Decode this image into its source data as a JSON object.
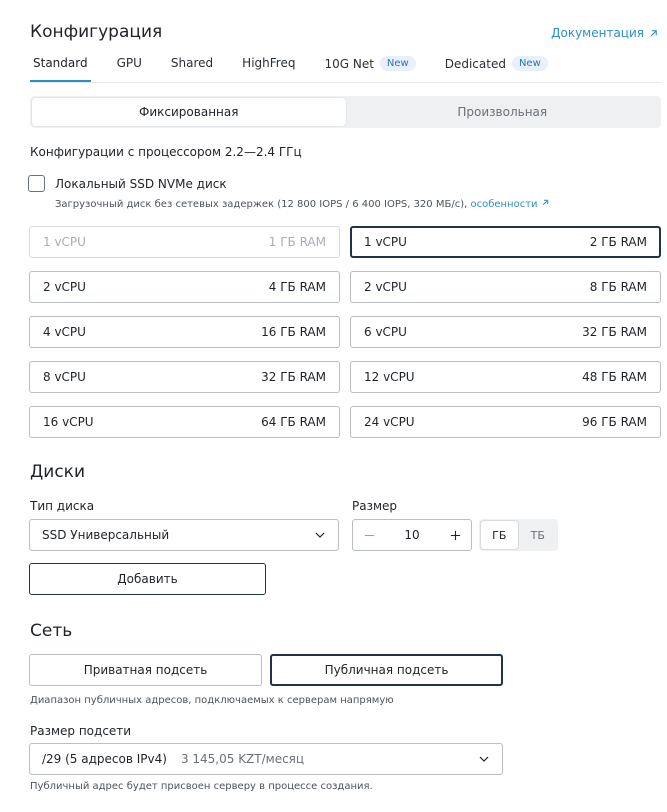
{
  "header": {
    "title": "Конфигурация",
    "docs_link": "Документация"
  },
  "tabs": [
    {
      "label": "Standard",
      "active": true,
      "badge": ""
    },
    {
      "label": "GPU",
      "active": false,
      "badge": ""
    },
    {
      "label": "Shared",
      "active": false,
      "badge": ""
    },
    {
      "label": "HighFreq",
      "active": false,
      "badge": ""
    },
    {
      "label": "10G Net",
      "active": false,
      "badge": "New"
    },
    {
      "label": "Dedicated",
      "active": false,
      "badge": "New"
    }
  ],
  "mode": {
    "fixed": "Фиксированная",
    "custom": "Произвольная",
    "selected": "fixed"
  },
  "cpu_note": "Конфигурации с процессором 2.2—2.4 ГГц",
  "local_ssd": {
    "label": "Локальный SSD NVMe диск",
    "checked": false,
    "hint": "Загрузочный диск без сетевых задержек (12 800 IOPS / 6 400 IOPS, 320 МБ/с),",
    "hint_link": "особенности"
  },
  "configs": [
    {
      "cpu": "1 vCPU",
      "ram": "1 ГБ RAM",
      "state": "disabled"
    },
    {
      "cpu": "1 vCPU",
      "ram": "2 ГБ RAM",
      "state": "selected"
    },
    {
      "cpu": "2 vCPU",
      "ram": "4 ГБ RAM",
      "state": "normal"
    },
    {
      "cpu": "2 vCPU",
      "ram": "8 ГБ RAM",
      "state": "normal"
    },
    {
      "cpu": "4 vCPU",
      "ram": "16 ГБ RAM",
      "state": "normal"
    },
    {
      "cpu": "6 vCPU",
      "ram": "32 ГБ RAM",
      "state": "normal"
    },
    {
      "cpu": "8 vCPU",
      "ram": "32 ГБ RAM",
      "state": "normal"
    },
    {
      "cpu": "12 vCPU",
      "ram": "48 ГБ RAM",
      "state": "normal"
    },
    {
      "cpu": "16 vCPU",
      "ram": "64 ГБ RAM",
      "state": "normal"
    },
    {
      "cpu": "24 vCPU",
      "ram": "96 ГБ RAM",
      "state": "normal"
    }
  ],
  "disks": {
    "heading": "Диски",
    "type_label": "Тип диска",
    "type_value": "SSD Универсальный",
    "size_label": "Размер",
    "size_value": "10",
    "unit_gb": "ГБ",
    "unit_tb": "ТБ",
    "unit_selected": "gb",
    "add_button": "Добавить"
  },
  "network": {
    "heading": "Сеть",
    "private": "Приватная подсеть",
    "public": "Публичная подсеть",
    "selected": "public",
    "hint": "Диапазон публичных адресов, подключаемых к серверам напрямую",
    "subnet_label": "Размер подсети",
    "subnet_value": "/29 (5 адресов IPv4)",
    "subnet_price": "3 145,05 KZT/месяц",
    "bottom_hint": "Публичный адрес будет присвоен серверу в процессе создания."
  },
  "colors": {
    "accent": "#2b8fc7",
    "selected_border": "#1f3447",
    "badge_bg": "#e7f0fb"
  }
}
